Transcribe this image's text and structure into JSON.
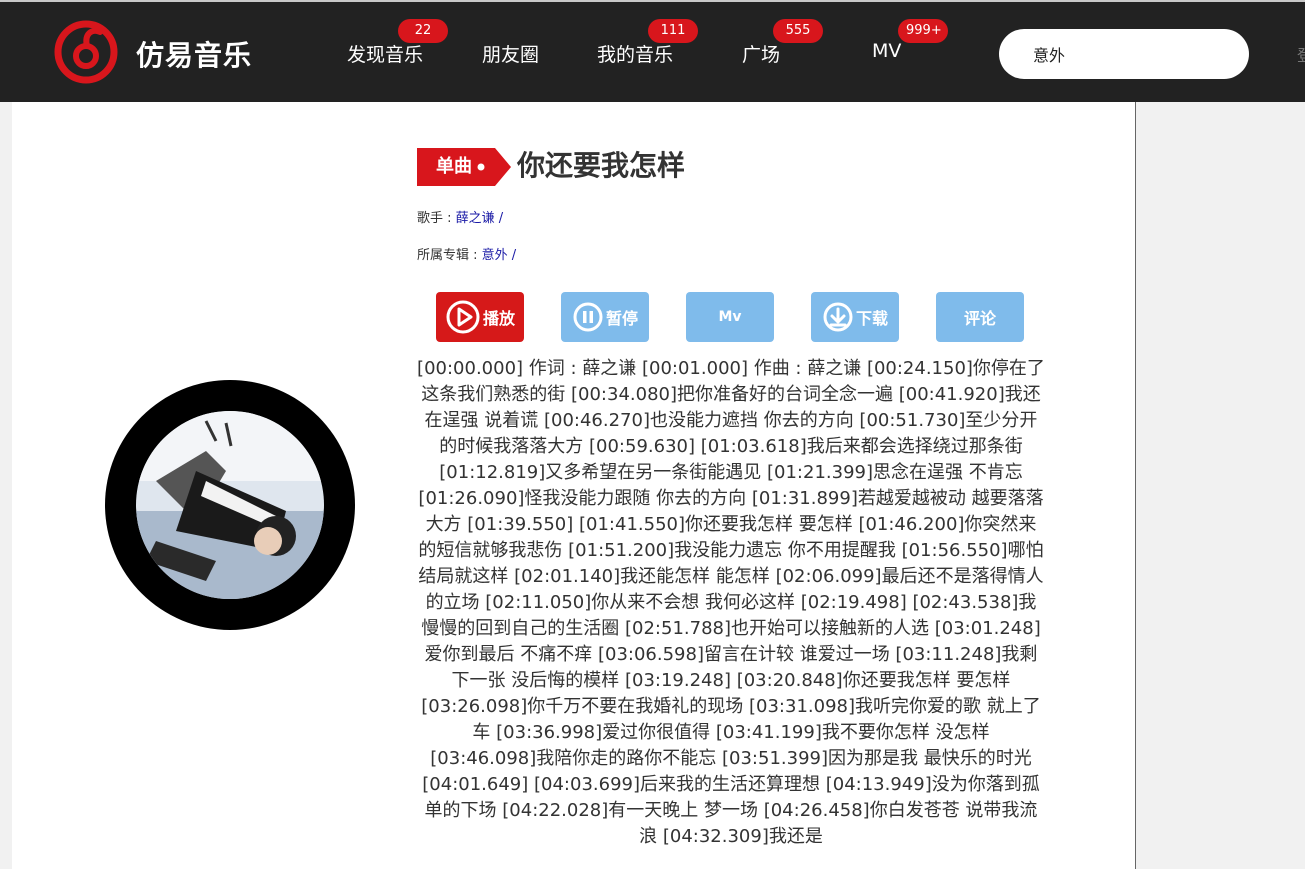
{
  "app": {
    "brand": "仿易音乐"
  },
  "nav": [
    {
      "label": "发现音乐",
      "badge": "22"
    },
    {
      "label": "朋友圈",
      "badge": ""
    },
    {
      "label": "我的音乐",
      "badge": "111"
    },
    {
      "label": "广场",
      "badge": "555"
    },
    {
      "label": "MV",
      "badge": "999+"
    }
  ],
  "search": {
    "value": "意外"
  },
  "colors": {
    "brand_red": "#d8161c",
    "topbar": "#222222",
    "button_blue": "#7fbbeb"
  },
  "song": {
    "tag": "单曲",
    "title": "你还要我怎样",
    "singer_label": "歌手 : ",
    "singer": "薛之谦 /",
    "album_label": "所属专辑 : ",
    "album": "意外 /"
  },
  "buttons": {
    "play": "播放",
    "pause": "暂停",
    "mv": "Mv",
    "download": "下载",
    "comment": "评论"
  },
  "lyrics": "[00:00.000] 作词 : 薛之谦 [00:01.000] 作曲 : 薛之谦 [00:24.150]你停在了这条我们熟悉的街 [00:34.080]把你准备好的台词全念一遍 [00:41.920]我还在逞强 说着谎 [00:46.270]也没能力遮挡 你去的方向 [00:51.730]至少分开的时候我落落大方 [00:59.630] [01:03.618]我后来都会选择绕过那条街 [01:12.819]又多希望在另一条街能遇见 [01:21.399]思念在逞强 不肯忘 [01:26.090]怪我没能力跟随 你去的方向 [01:31.899]若越爱越被动 越要落落大方 [01:39.550] [01:41.550]你还要我怎样 要怎样 [01:46.200]你突然来的短信就够我悲伤 [01:51.200]我没能力遗忘 你不用提醒我 [01:56.550]哪怕结局就这样 [02:01.140]我还能怎样 能怎样 [02:06.099]最后还不是落得情人的立场 [02:11.050]你从来不会想 我何必这样 [02:19.498] [02:43.538]我慢慢的回到自己的生活圈 [02:51.788]也开始可以接触新的人选 [03:01.248]爱你到最后 不痛不痒 [03:06.598]留言在计较 谁爱过一场 [03:11.248]我剩下一张 没后悔的模样 [03:19.248] [03:20.848]你还要我怎样 要怎样 [03:26.098]你千万不要在我婚礼的现场 [03:31.098]我听完你爱的歌 就上了车 [03:36.998]爱过你很值得 [03:41.199]我不要你怎样 没怎样 [03:46.098]我陪你走的路你不能忘 [03:51.399]因为那是我 最快乐的时光 [04:01.649] [04:03.699]后来我的生活还算理想 [04:13.949]没为你落到孤单的下场 [04:22.028]有一天晚上 梦一场 [04:26.458]你白发苍苍 说带我流浪 [04:32.309]我还是"
}
